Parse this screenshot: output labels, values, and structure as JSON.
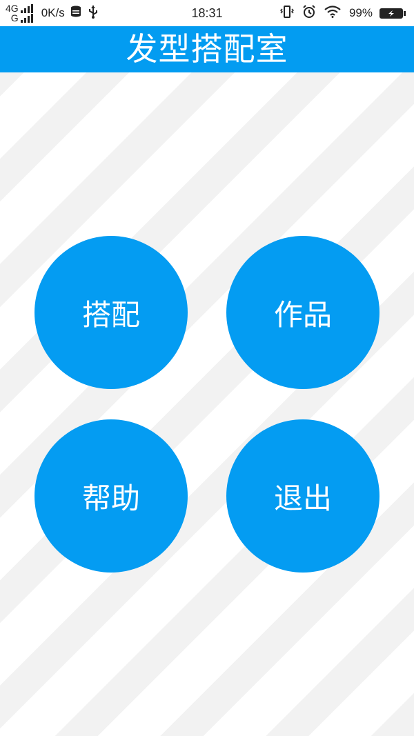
{
  "status_bar": {
    "network_top": "4G",
    "network_bottom": "G",
    "speed": "0K/s",
    "time": "18:31",
    "battery": "99%",
    "icons": [
      "data-icon",
      "usb-icon",
      "vibrate-icon",
      "alarm-icon",
      "wifi-icon",
      "battery-icon"
    ]
  },
  "title_bar": {
    "title": "发型搭配室"
  },
  "menu": {
    "match_label": "搭配",
    "works_label": "作品",
    "help_label": "帮助",
    "exit_label": "退出"
  },
  "colors": {
    "accent": "#039cf1",
    "button": "#049cf2",
    "stripe_light": "#f2f2f2",
    "background": "#ffffff"
  }
}
